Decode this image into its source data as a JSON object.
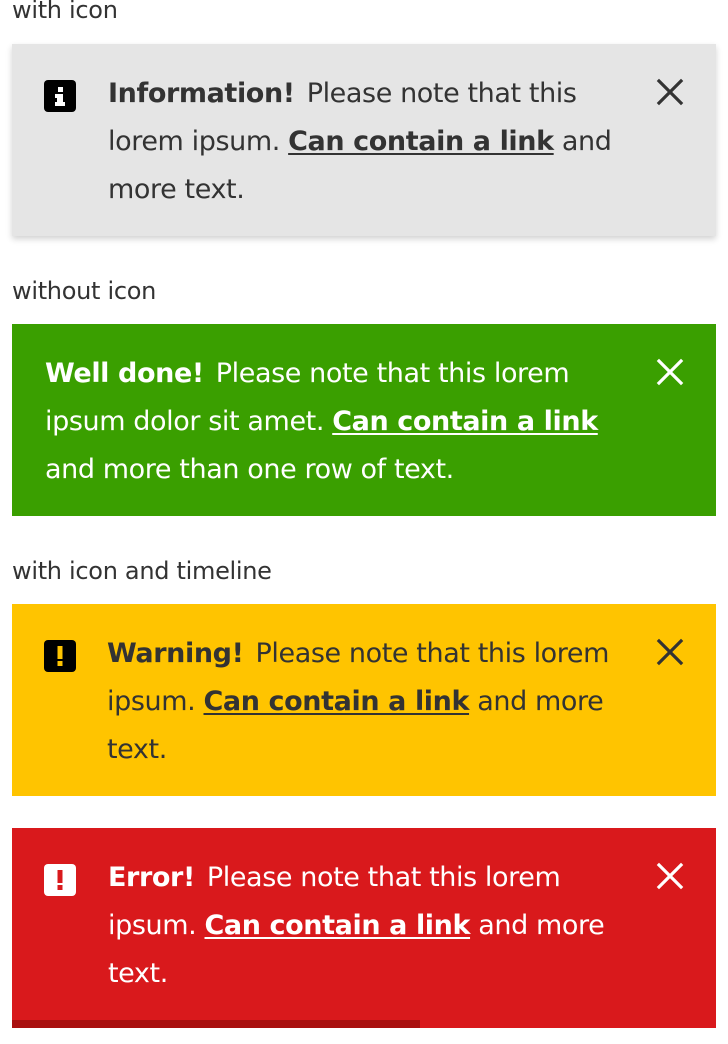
{
  "sections": {
    "with_icon": "with icon",
    "without_icon": "without icon",
    "with_icon_and_timeline": "with icon and timeline"
  },
  "alerts": {
    "info": {
      "lead": "Information!",
      "text_before": "Please note that this lorem ipsum.",
      "link": "Can contain a link",
      "text_after": "and more text.",
      "icon": "info-icon",
      "background": "#e5e5e5"
    },
    "success": {
      "lead": "Well done!",
      "text_before": "Please note that this lorem ipsum dolor sit amet.",
      "link": "Can contain a link",
      "text_after": "and more than one row of text.",
      "background": "#3a9f00"
    },
    "warning": {
      "lead": "Warning!",
      "text_before": "Please note that this lorem ipsum.",
      "link": "Can contain a link",
      "text_after": "and more text.",
      "icon": "warning-icon",
      "background": "#ffc400"
    },
    "error": {
      "lead": "Error!",
      "text_before": "Please note that this lorem ipsum.",
      "link": "Can contain a link",
      "text_after": "and more text.",
      "icon": "error-icon",
      "background": "#d9191c",
      "timeline_progress": 0.58
    }
  }
}
